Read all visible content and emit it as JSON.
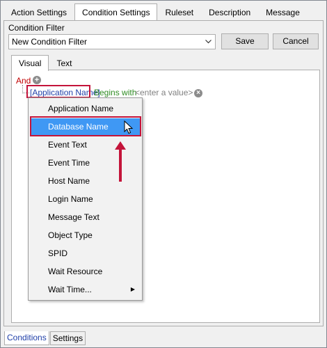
{
  "top_tabs": [
    {
      "label": "Action Settings"
    },
    {
      "label": "Condition Settings"
    },
    {
      "label": "Ruleset"
    },
    {
      "label": "Description"
    },
    {
      "label": "Message"
    }
  ],
  "condition_filter": {
    "label": "Condition Filter",
    "selected": "New Condition Filter",
    "save_label": "Save",
    "cancel_label": "Cancel"
  },
  "inner_tabs": [
    {
      "label": "Visual"
    },
    {
      "label": "Text"
    }
  ],
  "condition": {
    "group_operator": "And",
    "field": "[Application Name]",
    "operator": "Begins with",
    "value_placeholder": "<enter a value>"
  },
  "menu": {
    "items": [
      {
        "label": "Application Name"
      },
      {
        "label": "Database Name"
      },
      {
        "label": "Event Text"
      },
      {
        "label": "Event Time"
      },
      {
        "label": "Host Name"
      },
      {
        "label": "Login Name"
      },
      {
        "label": "Message Text"
      },
      {
        "label": "Object Type"
      },
      {
        "label": "SPID"
      },
      {
        "label": "Wait Resource"
      },
      {
        "label": "Wait Time..."
      }
    ],
    "selected_index": 1
  },
  "bottom_tabs": [
    {
      "label": "Conditions"
    },
    {
      "label": "Settings"
    }
  ],
  "colors": {
    "highlight": "#c4143a",
    "selection": "#3f98f4",
    "and_red": "#c00000",
    "field_blue": "#1f3fa8",
    "operator_green": "#2e8b22"
  },
  "icons": {
    "add": "plus-circle-icon",
    "remove": "close-circle-icon",
    "dropdown": "chevron-down-icon",
    "submenu": "triangle-right-icon"
  }
}
